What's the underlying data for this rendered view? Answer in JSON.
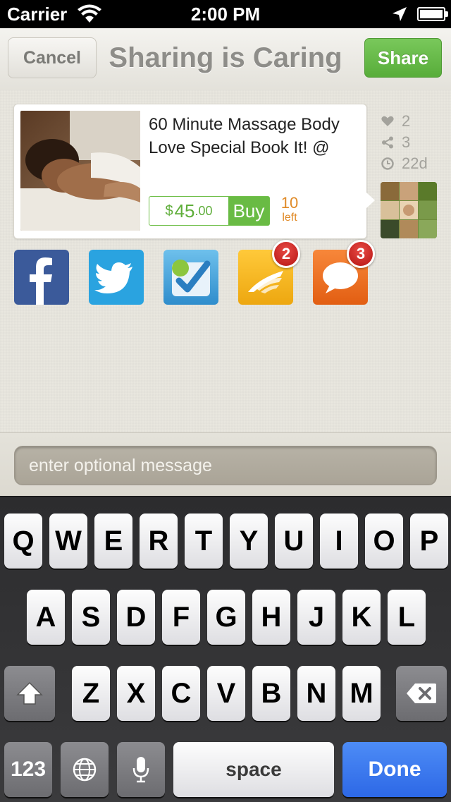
{
  "status_bar": {
    "carrier": "Carrier",
    "time": "2:00 PM"
  },
  "nav": {
    "cancel_label": "Cancel",
    "title": "Sharing is Caring",
    "share_label": "Share"
  },
  "deal": {
    "title": "60 Minute Massage Body Love Special Book It! @",
    "currency": "$",
    "price_whole": "45",
    "price_cents": ".00",
    "buy_label": "Buy",
    "left_count": "10",
    "left_label": "left"
  },
  "stats": {
    "likes": "2",
    "shares": "3",
    "age": "22d"
  },
  "share_targets": [
    {
      "name": "Facebook",
      "color": "#3b5a9a"
    },
    {
      "name": "Twitter",
      "color": "#2aa3e0"
    },
    {
      "name": "Foursquare",
      "color": "#4aa3d8"
    },
    {
      "name": "Mail",
      "color": "#f1b21a",
      "badge": "2"
    },
    {
      "name": "Messages",
      "color": "#ec6f1e",
      "badge": "3"
    }
  ],
  "message": {
    "placeholder": "enter optional message"
  },
  "keyboard": {
    "row1": [
      "Q",
      "W",
      "E",
      "R",
      "T",
      "Y",
      "U",
      "I",
      "O",
      "P"
    ],
    "row2": [
      "A",
      "S",
      "D",
      "F",
      "G",
      "H",
      "J",
      "K",
      "L"
    ],
    "row3": [
      "Z",
      "X",
      "C",
      "V",
      "B",
      "N",
      "M"
    ],
    "numbers_label": "123",
    "space_label": "space",
    "done_label": "Done"
  }
}
